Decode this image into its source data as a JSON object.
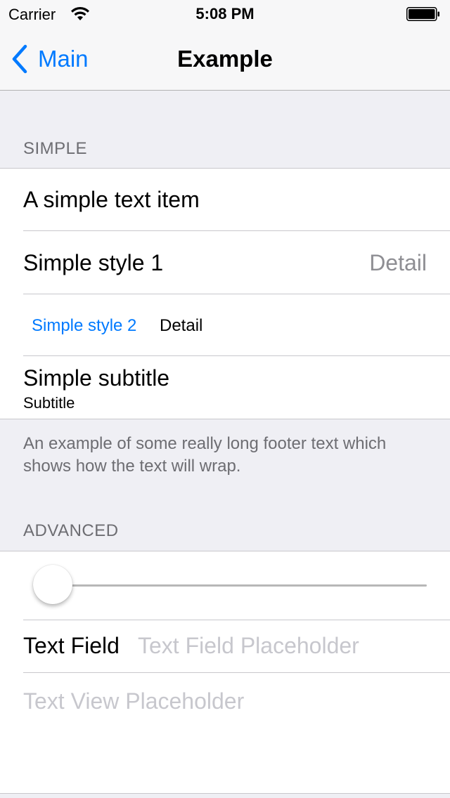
{
  "status_bar": {
    "carrier": "Carrier",
    "time": "5:08 PM"
  },
  "nav": {
    "back_label": "Main",
    "title": "Example",
    "accent_color": "#007aff"
  },
  "sections": {
    "simple": {
      "header": "SIMPLE",
      "rows": {
        "text_item": {
          "title": "A simple text item"
        },
        "style1": {
          "title": "Simple style 1",
          "detail": "Detail"
        },
        "style2": {
          "title": "Simple style 2",
          "detail": "Detail"
        },
        "subtitle": {
          "title": "Simple subtitle",
          "subtitle": "Subtitle"
        }
      },
      "footer": "An example of some really long footer text which shows how the text will wrap."
    },
    "advanced": {
      "header": "ADVANCED",
      "slider": {
        "value": 0
      },
      "text_field": {
        "label": "Text Field",
        "value": "",
        "placeholder": "Text Field Placeholder"
      },
      "text_view": {
        "value": "",
        "placeholder": "Text View Placeholder"
      }
    }
  }
}
